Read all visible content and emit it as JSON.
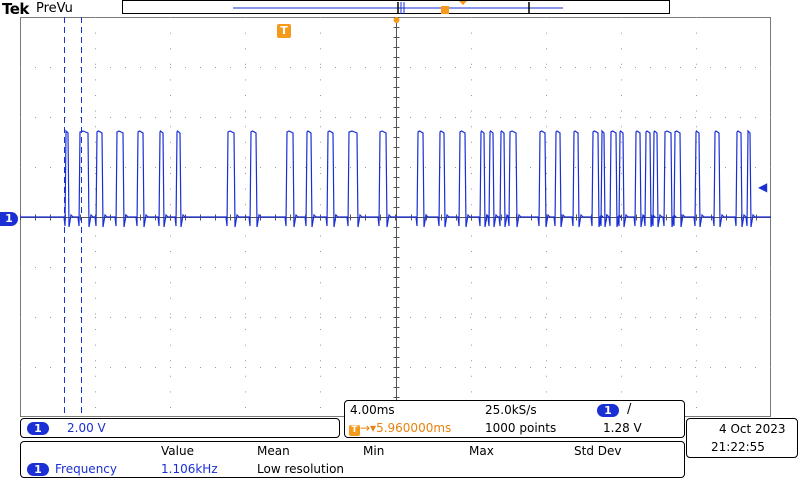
{
  "header": {
    "brand": "Tek",
    "mode": "PreVu"
  },
  "colors": {
    "channel1": "#1a2fd4",
    "trigger": "#f59a1b",
    "grid": "#7a7a7a"
  },
  "markers": {
    "trigger_label": "T",
    "channel1_label": "1",
    "trigger_level_icon": "left-arrow-icon"
  },
  "channel_box": {
    "channel": "1",
    "scale": "2.00 V"
  },
  "timebase_box": {
    "time_per_div": "4.00ms",
    "sample_rate": "25.0kS/s",
    "trigger_channel": "1",
    "trigger_slope": "/",
    "trigger_position": "5.960000ms",
    "record_length": "1000 points",
    "trigger_level": "1.28 V"
  },
  "datetime": {
    "date": "4 Oct  2023",
    "time": "21:22:55"
  },
  "measurements": {
    "headers": [
      "Value",
      "Mean",
      "Min",
      "Max",
      "Std Dev"
    ],
    "rows": [
      {
        "channel": "1",
        "name": "Frequency",
        "value": "1.106kHz",
        "note": "Low resolution"
      }
    ]
  },
  "cursors": {
    "type": "vertical",
    "count": 2
  }
}
